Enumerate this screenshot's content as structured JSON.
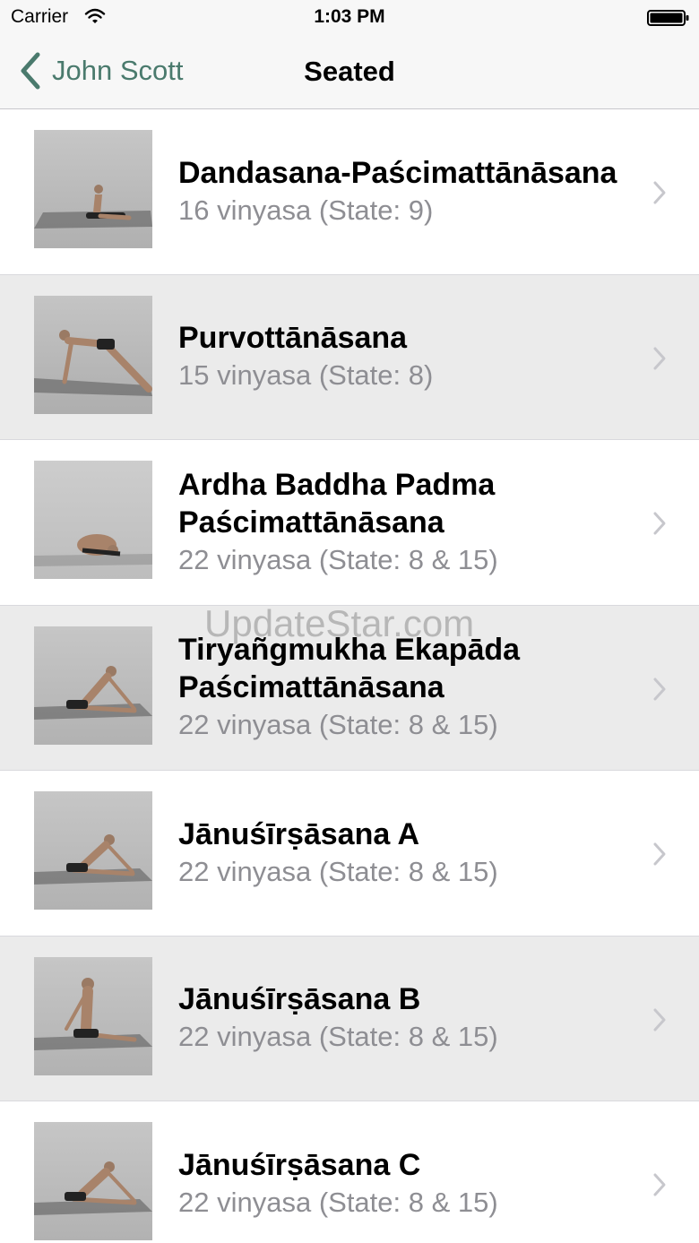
{
  "status_bar": {
    "carrier": "Carrier",
    "time": "1:03 PM"
  },
  "nav": {
    "back_label": "John Scott",
    "title": "Seated"
  },
  "poses": [
    {
      "name": "Dandasana-Paścimattānāsana",
      "detail": "16 vinyasa (State: 9)"
    },
    {
      "name": "Purvottānāsana",
      "detail": "15 vinyasa (State: 8)"
    },
    {
      "name": "Ardha Baddha Padma Paścimattānāsana",
      "detail": "22 vinyasa (State: 8 & 15)"
    },
    {
      "name": "Tiryañgmukha Ekapāda Paścimattānāsana",
      "detail": "22 vinyasa (State: 8 & 15)"
    },
    {
      "name": "Jānuśīrṣāsana A",
      "detail": "22 vinyasa (State: 8 & 15)"
    },
    {
      "name": "Jānuśīrṣāsana B",
      "detail": "22 vinyasa (State: 8 & 15)"
    },
    {
      "name": "Jānuśīrṣāsana C",
      "detail": "22 vinyasa (State: 8 & 15)"
    }
  ],
  "watermark": "UpdateStar.com",
  "colors": {
    "accent": "#4a7a6d",
    "bar_background": "#f7f7f7",
    "shaded_row": "#ebebeb",
    "detail_text": "#8e8e93"
  }
}
